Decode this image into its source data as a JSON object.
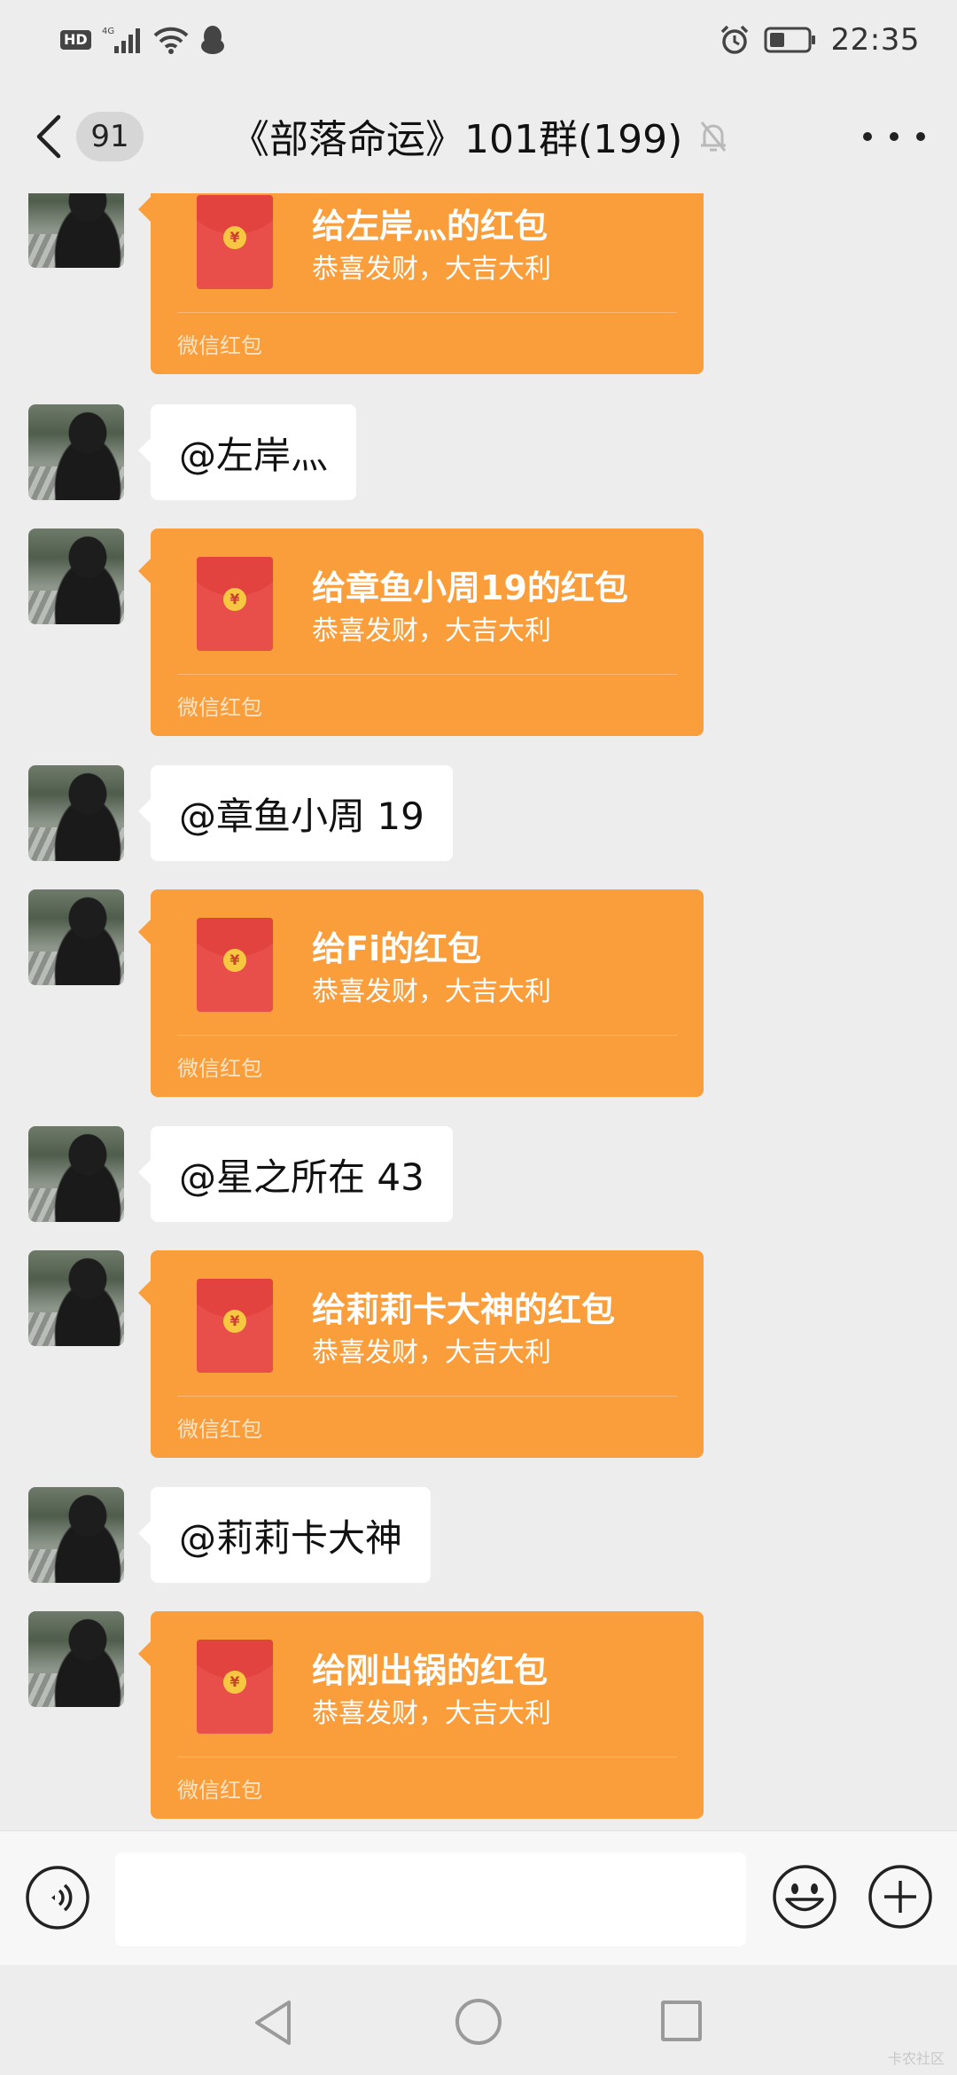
{
  "status_bar": {
    "hd_label": "HD",
    "network_label": "4G",
    "time": "22:35"
  },
  "nav": {
    "unread_count": "91",
    "title": "《部落命运》101群(199)"
  },
  "messages": [
    {
      "type": "red_packet",
      "title": "给左岸灬的红包",
      "subtitle": "恭喜发财，大吉大利",
      "footer": "微信红包"
    },
    {
      "type": "text",
      "text": "@左岸灬"
    },
    {
      "type": "red_packet",
      "title": "给章鱼小周19的红包",
      "subtitle": "恭喜发财，大吉大利",
      "footer": "微信红包"
    },
    {
      "type": "text",
      "text": "@章鱼小周 19"
    },
    {
      "type": "red_packet",
      "title": "给Fi的红包",
      "subtitle": "恭喜发财，大吉大利",
      "footer": "微信红包"
    },
    {
      "type": "text",
      "text": "@星之所在 43"
    },
    {
      "type": "red_packet",
      "title": "给莉莉卡大神的红包",
      "subtitle": "恭喜发财，大吉大利",
      "footer": "微信红包"
    },
    {
      "type": "text",
      "text": "@莉莉卡大神"
    },
    {
      "type": "red_packet",
      "title": "给刚出锅的红包",
      "subtitle": "恭喜发财，大吉大利",
      "footer": "微信红包"
    }
  ],
  "red_packet_symbol": "¥",
  "input": {
    "value": "",
    "placeholder": ""
  },
  "watermark": "卡农社区",
  "colors": {
    "red_packet_bg": "#fa9d3b",
    "envelope": "#e84f4b",
    "chat_bg": "#ededed"
  },
  "icons": {
    "back": "chevron-left-icon",
    "mute": "bell-muted-icon",
    "more": "more-dots-icon",
    "voice": "voice-icon",
    "emoji": "smiley-icon",
    "plus": "plus-circle-icon"
  }
}
